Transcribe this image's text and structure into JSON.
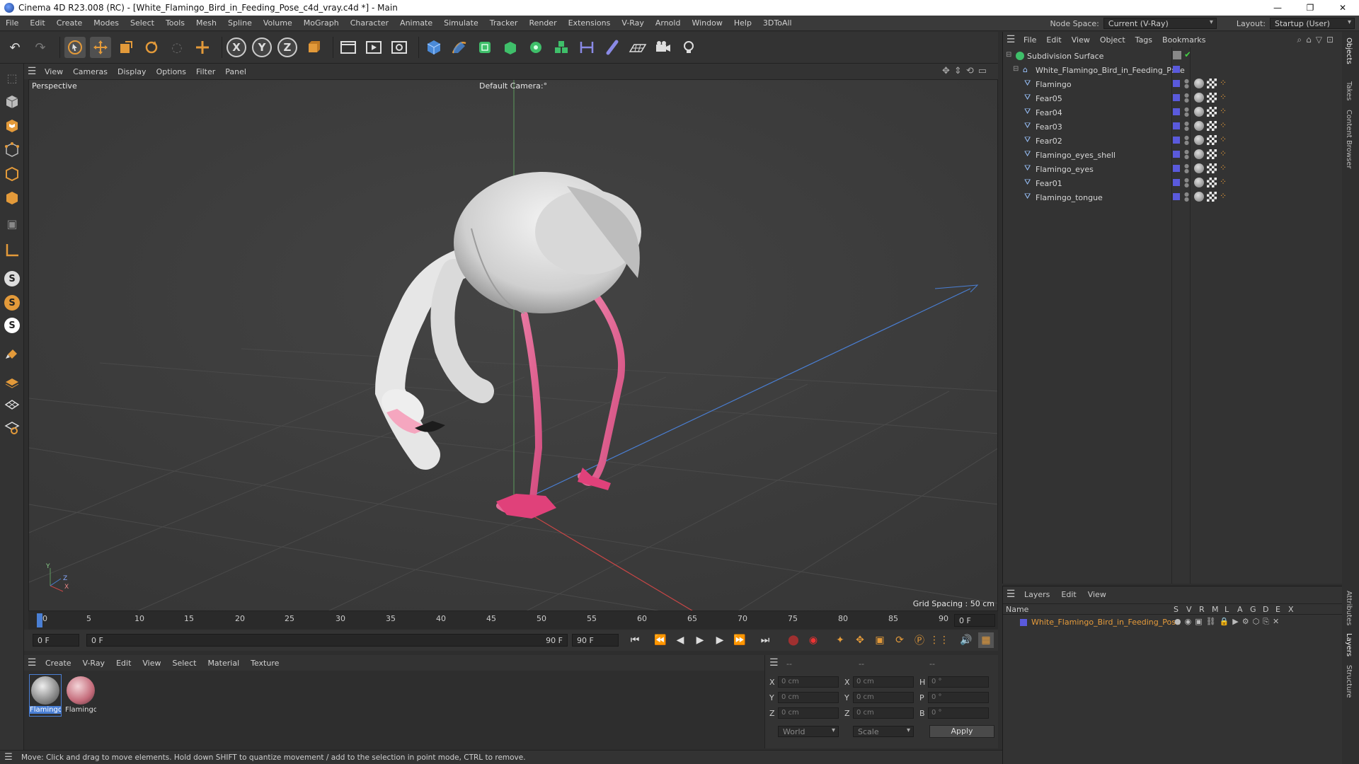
{
  "window": {
    "title": "Cinema 4D R23.008 (RC) - [White_Flamingo_Bird_in_Feeding_Pose_c4d_vray.c4d *] - Main",
    "minimize": "—",
    "maximize": "❐",
    "close": "✕"
  },
  "menubar": {
    "items": [
      "File",
      "Edit",
      "Create",
      "Modes",
      "Select",
      "Tools",
      "Mesh",
      "Spline",
      "Volume",
      "MoGraph",
      "Character",
      "Animate",
      "Simulate",
      "Tracker",
      "Render",
      "Extensions",
      "V-Ray",
      "Arnold",
      "Window",
      "Help",
      "3DToAll"
    ],
    "node_space_label": "Node Space:",
    "node_space_value": "Current (V-Ray)",
    "layout_label": "Layout:",
    "layout_value": "Startup (User)"
  },
  "toolbar": {
    "x_label": "X",
    "y_label": "Y",
    "z_label": "Z"
  },
  "left_strip": {
    "s1": "S",
    "s2": "S",
    "s3": "S"
  },
  "viewport": {
    "menu": [
      "View",
      "Cameras",
      "Display",
      "Options",
      "Filter",
      "Panel"
    ],
    "view_name": "Perspective",
    "camera": "Default Camera",
    "camera_suffix": ":°",
    "grid_spacing": "Grid Spacing : 50 cm",
    "axis_y": "Y",
    "axis_z": "Z",
    "axis_x": "X"
  },
  "timeline": {
    "ticks": [
      "0",
      "5",
      "10",
      "15",
      "20",
      "25",
      "30",
      "35",
      "40",
      "45",
      "50",
      "55",
      "60",
      "65",
      "70",
      "75",
      "80",
      "85",
      "90"
    ],
    "current_frame": "0 F"
  },
  "playbar": {
    "start_field": "0 F",
    "range_start": "0 F",
    "range_end": "90 F",
    "end_field": "90 F"
  },
  "material_manager": {
    "menu": [
      "Create",
      "V-Ray",
      "Edit",
      "View",
      "Select",
      "Material",
      "Texture"
    ],
    "materials": [
      {
        "name": "Flamingo"
      },
      {
        "name": "Flamingo"
      }
    ]
  },
  "coordinates": {
    "header_1": "--",
    "header_2": "--",
    "header_3": "--",
    "rows": [
      {
        "l1": "X",
        "v1": "0 cm",
        "l2": "X",
        "v2": "0 cm",
        "l3": "H",
        "v3": "0 °"
      },
      {
        "l1": "Y",
        "v1": "0 cm",
        "l2": "Y",
        "v2": "0 cm",
        "l3": "P",
        "v3": "0 °"
      },
      {
        "l1": "Z",
        "v1": "0 cm",
        "l2": "Z",
        "v2": "0 cm",
        "l3": "B",
        "v3": "0 °"
      }
    ],
    "world": "World",
    "scale": "Scale",
    "apply": "Apply"
  },
  "status": {
    "text": "Move: Click and drag to move elements. Hold down SHIFT to quantize movement / add to the selection in point mode, CTRL to remove."
  },
  "object_manager": {
    "menu": [
      "File",
      "Edit",
      "View",
      "Object",
      "Tags",
      "Bookmarks"
    ],
    "objects": [
      {
        "name": "Subdivision Surface"
      },
      {
        "name": "White_Flamingo_Bird_in_Feeding_Pose"
      },
      {
        "name": "Flamingo"
      },
      {
        "name": "Fear05"
      },
      {
        "name": "Fear04"
      },
      {
        "name": "Fear03"
      },
      {
        "name": "Fear02"
      },
      {
        "name": "Flamingo_eyes_shell"
      },
      {
        "name": "Flamingo_eyes"
      },
      {
        "name": "Fear01"
      },
      {
        "name": "Flamingo_tongue"
      }
    ]
  },
  "layer_manager": {
    "menu": [
      "Layers",
      "Edit",
      "View"
    ],
    "name_header": "Name",
    "columns": [
      "S",
      "V",
      "R",
      "M",
      "L",
      "A",
      "G",
      "D",
      "E",
      "X"
    ],
    "layer_name": "White_Flamingo_Bird_in_Feeding_Pose",
    "layer_color": "#5a5adc"
  },
  "right_tabs": [
    "Objects",
    "Takes",
    "Content Browser",
    "Attributes",
    "Layers",
    "Structure"
  ],
  "colors": {
    "accent": "#4a7fd4",
    "layer_text": "#e59b3b"
  }
}
